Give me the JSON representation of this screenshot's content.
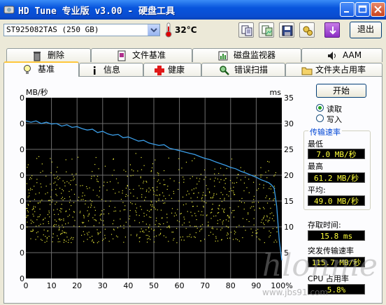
{
  "window": {
    "title": "HD Tune 专业版 v3.00 - 硬盘工具"
  },
  "toolbar": {
    "drive": "ST925082TAS (250 GB)",
    "temperature": "32°C",
    "exit_label": "退出",
    "icons": [
      "copy-text-icon",
      "copy-image-icon",
      "save-icon",
      "options-icon",
      "download-icon"
    ]
  },
  "tabs_row1": [
    "删除",
    "文件基准",
    "磁盘监视器",
    "AAM"
  ],
  "tabs_row2": [
    "基准",
    "信息",
    "健康",
    "错误扫描",
    "文件夹占用率"
  ],
  "active_tab": "基准",
  "sidebar": {
    "start_label": "开始",
    "read_label": "读取",
    "write_label": "写入",
    "mode": "read",
    "transfer_title": "传输速率",
    "min_label": "最低",
    "min_value": "7.0 MB/秒",
    "max_label": "最高",
    "max_value": "61.2 MB/秒",
    "avg_label": "平均:",
    "avg_value": "49.0 MB/秒",
    "access_label": "存取时间:",
    "access_value": "15.8 ms",
    "burst_label": "突发传输速率",
    "burst_value": "115.7 MB/秒",
    "cpu_label": "CPU 占用率",
    "cpu_value": "5.8%"
  },
  "colors": {
    "transfer_line": "#3b9ee8",
    "access_dots": "#e8e83a",
    "plot_bg": "#000000",
    "grid": "#6e6e6e"
  },
  "chart_data": {
    "type": "line",
    "xlabel": "",
    "x_ticks": [
      "0",
      "10",
      "20",
      "30",
      "40",
      "50",
      "60",
      "70",
      "80",
      "90",
      "100%"
    ],
    "y_left_label": "MB/秒",
    "y_left_ticks": [
      0,
      10,
      20,
      30,
      40,
      50,
      60,
      70
    ],
    "y_right_label": "ms",
    "y_right_ticks": [
      5,
      10,
      15,
      20,
      25,
      30,
      35
    ],
    "ylim_left": [
      0,
      70
    ],
    "ylim_right": [
      0,
      35
    ],
    "grid": true,
    "series": [
      {
        "axis": "left",
        "x": [
          0,
          2,
          4,
          6,
          8,
          10,
          12,
          14,
          16,
          18,
          20,
          22,
          24,
          26,
          28,
          30,
          32,
          34,
          36,
          38,
          40,
          42,
          44,
          46,
          48,
          50,
          52,
          54,
          56,
          58,
          60,
          62,
          64,
          66,
          68,
          70,
          72,
          74,
          76,
          78,
          80,
          82,
          84,
          86,
          88,
          90,
          92,
          94,
          95,
          96,
          97,
          98,
          99,
          100
        ],
        "values": [
          61,
          60.5,
          61,
          60,
          60.5,
          59.8,
          60,
          59,
          59.5,
          58.5,
          58.8,
          58,
          57.5,
          57.8,
          56.5,
          57,
          56,
          55.5,
          55.8,
          54.5,
          54.8,
          54,
          53.2,
          53.5,
          52.5,
          52,
          51.5,
          51.8,
          50.5,
          50,
          49.5,
          49,
          48.5,
          48,
          47.2,
          46.5,
          46,
          45.2,
          44.5,
          43.8,
          43,
          42.5,
          41.5,
          40.8,
          40,
          39.2,
          38.2,
          37.5,
          37,
          36.2,
          35,
          28,
          15,
          7
        ]
      },
      {
        "axis": "right",
        "type": "scatter",
        "description_range_ms": [
          7,
          25
        ]
      }
    ]
  },
  "watermark": {
    "text": "www.jbs91.com",
    "brand": "hlonme"
  }
}
